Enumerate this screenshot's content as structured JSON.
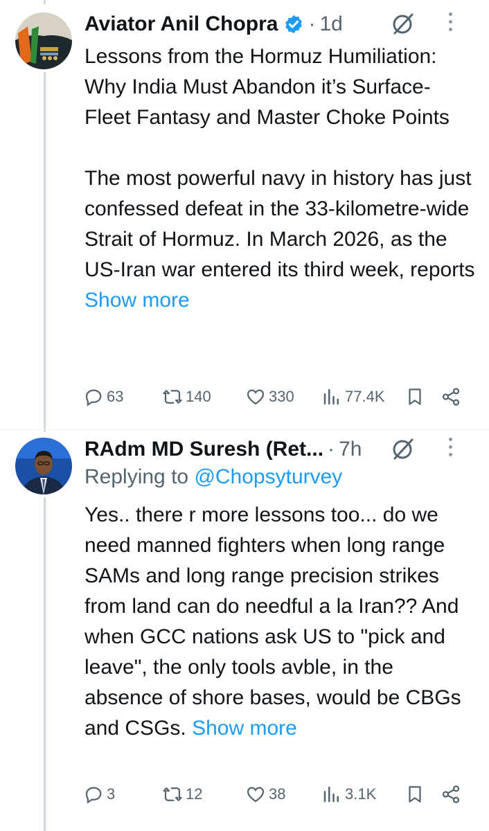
{
  "tweets": [
    {
      "author": "Aviator Anil Chopra",
      "verified": true,
      "time": "1d",
      "paragraph1": "Lessons from the Hormuz Humiliation: Why India Must Abandon it’s Surface-Fleet Fantasy and Master Choke Points",
      "paragraph2": "The most powerful navy in history has just confessed defeat in the 33-kilometre-wide Strait of Hormuz. In March 2026, as the US-Iran war entered its third week, reports",
      "show_more": "Show more",
      "replies": "63",
      "reposts": "140",
      "likes": "330",
      "views": "77.4K"
    },
    {
      "author": "RAdm MD Suresh (Ret...",
      "time": "7h",
      "replying_prefix": "Replying to",
      "replying_handle": "@Chopsyturvey",
      "paragraph1": "Yes.. there r more lessons too... do we  need manned fighters when long range SAMs and long range precision strikes from land can do needful a la Iran?? And when GCC nations ask US to \"pick and leave\", the only tools avble, in the absence of shore bases, would be CBGs and CSGs.",
      "show_more": "Show more",
      "replies": "3",
      "reposts": "12",
      "likes": "38",
      "views": "3.1K"
    }
  ],
  "colors": {
    "text": "#0f1419",
    "secondary": "#536471",
    "link": "#1d9bf0",
    "thread_line": "#cfd9de"
  },
  "icons": [
    "verified-badge-icon",
    "grok-icon",
    "more-icon",
    "reply-icon",
    "repost-icon",
    "like-icon",
    "views-icon",
    "bookmark-icon",
    "share-icon"
  ]
}
